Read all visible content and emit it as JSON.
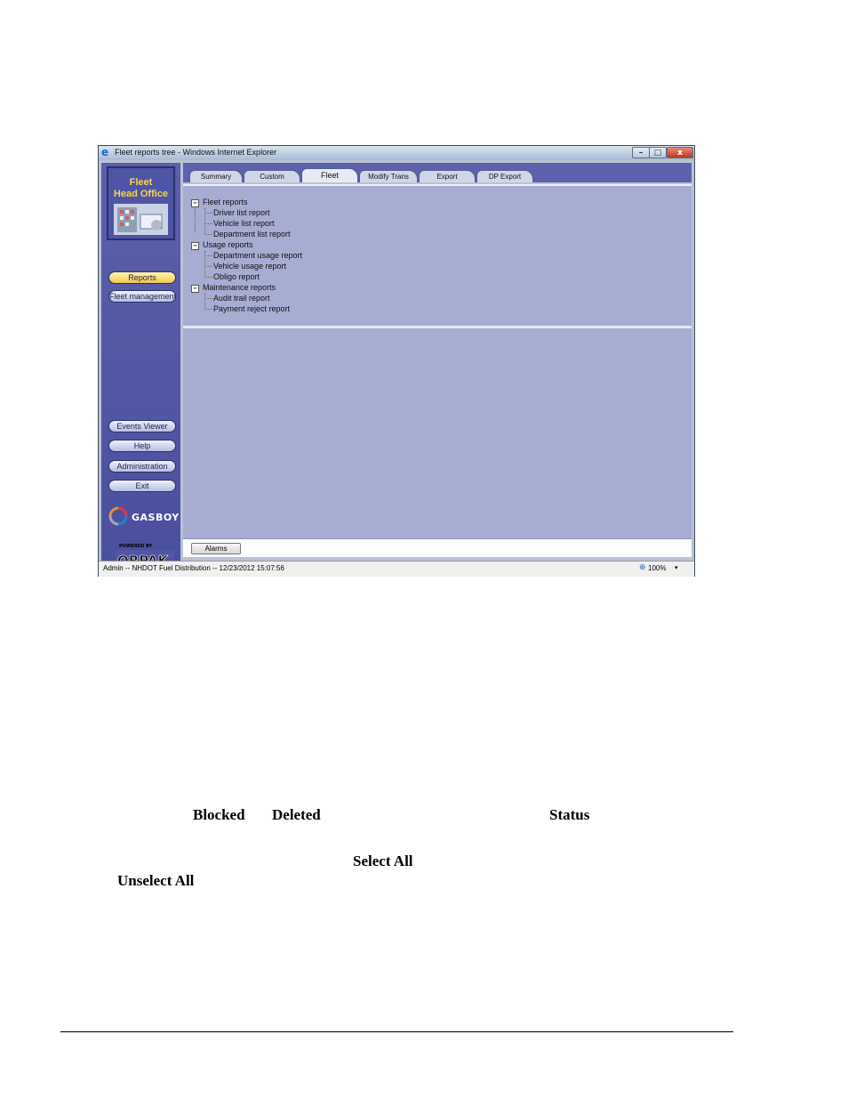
{
  "window": {
    "title": "Fleet reports tree - Windows Internet Explorer",
    "ie_icon": "e",
    "controls": {
      "minimize": "–",
      "maximize": "□",
      "close": "x"
    }
  },
  "sidebar": {
    "logo_line1": "Fleet",
    "logo_line2": "Head Office",
    "nav": {
      "reports": "Reports",
      "fleet_management": "Fleet management"
    },
    "tools": {
      "events_viewer": "Events Viewer",
      "help": "Help",
      "administration": "Administration",
      "exit": "Exit"
    },
    "brand_gasboy": "GASBOY",
    "brand_orpak_small": "POWERED BY",
    "brand_orpak": "ORPAK"
  },
  "tabs": [
    {
      "label": "Summary",
      "active": false
    },
    {
      "label": "Custom",
      "active": false
    },
    {
      "label": "Fleet",
      "active": true
    },
    {
      "label": "Modify Trans",
      "active": false
    },
    {
      "label": "Export",
      "active": false
    },
    {
      "label": "DP Export",
      "active": false
    }
  ],
  "tree": {
    "groups": [
      {
        "label": "Fleet reports",
        "items": [
          "Driver list report",
          "Vehicle list report",
          "Department list report"
        ]
      },
      {
        "label": "Usage reports",
        "items": [
          "Department usage report",
          "Vehicle usage report",
          "Obligo report"
        ]
      },
      {
        "label": "Maintenance reports",
        "items": [
          "Audit trail report",
          "Payment reject report"
        ]
      }
    ]
  },
  "footer": {
    "alarms_button": "Alarms"
  },
  "statusbar": {
    "text": "Admin -- NHDOT Fuel Distribution -- 12/23/2012  15:07:56",
    "zoom": "100%",
    "zoom_arrow": "▾"
  },
  "doc_text": {
    "blocked": "Blocked",
    "deleted": "Deleted",
    "status": "Status",
    "select_all": "Select All",
    "unselect_all": "Unselect All"
  },
  "colors": {
    "sidebar": "#5d5fab",
    "panel": "#a6acd2",
    "logo_text": "#f4d54d",
    "active_button": "#f0c94e"
  }
}
